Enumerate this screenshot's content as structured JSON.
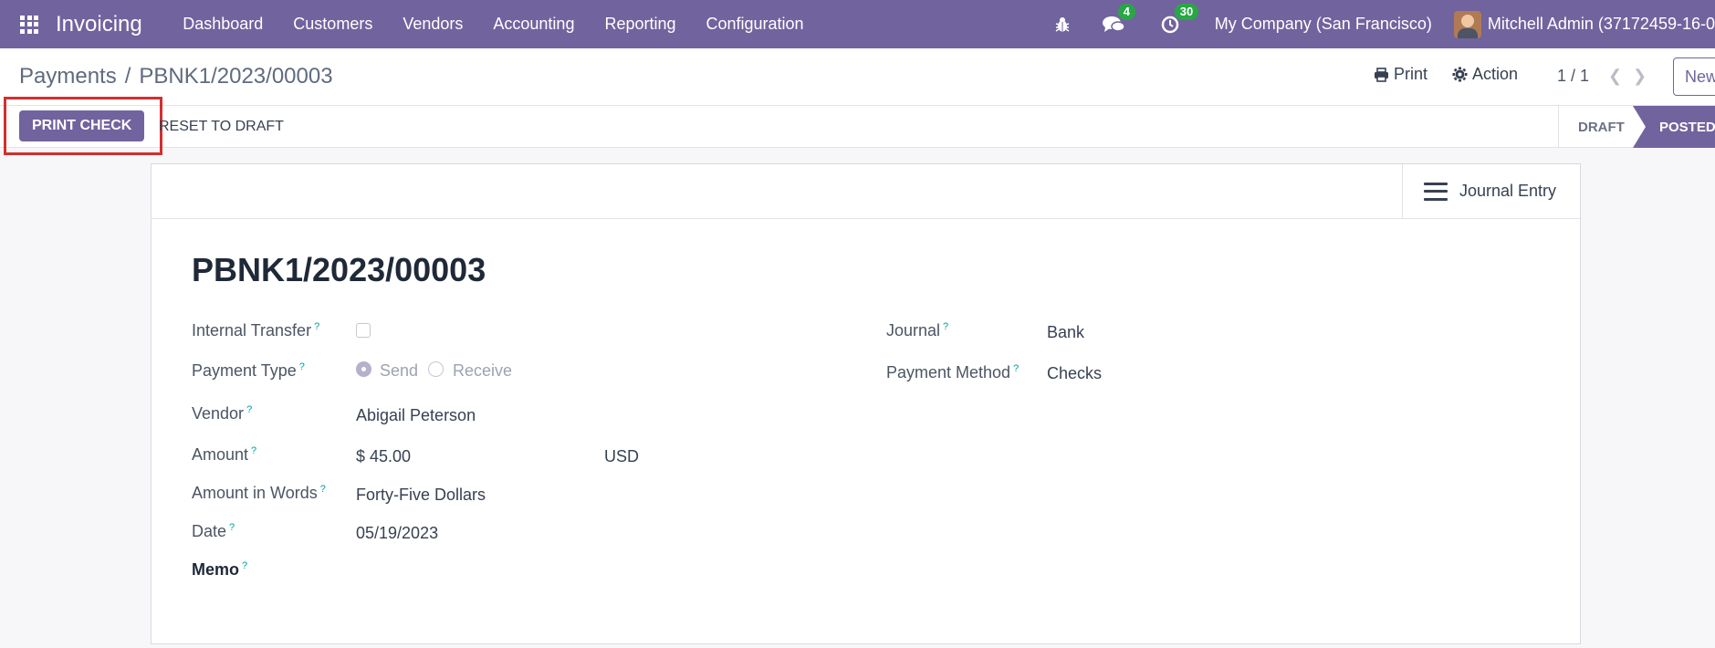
{
  "navbar": {
    "app_name": "Invoicing",
    "menu": [
      "Dashboard",
      "Customers",
      "Vendors",
      "Accounting",
      "Reporting",
      "Configuration"
    ],
    "chat_badge": "4",
    "activity_badge": "30",
    "company": "My Company (San Francisco)",
    "user": "Mitchell Admin (37172459-16-0"
  },
  "breadcrumb": {
    "parent": "Payments",
    "separator": "/",
    "current": "PBNK1/2023/00003"
  },
  "control": {
    "print_label": "Print",
    "action_label": "Action",
    "pager": "1 / 1",
    "new_label": "New"
  },
  "statusbar": {
    "print_check_label": "PRINT CHECK",
    "reset_label": "RESET TO DRAFT",
    "stages": [
      "DRAFT",
      "POSTED"
    ],
    "active_stage": "POSTED"
  },
  "smart_button": {
    "label": "Journal Entry",
    "icon": "bars-icon"
  },
  "form": {
    "title": "PBNK1/2023/00003",
    "help_marker": "?",
    "internal_transfer": {
      "label": "Internal Transfer",
      "checked": false
    },
    "payment_type": {
      "label": "Payment Type",
      "options": [
        "Send",
        "Receive"
      ],
      "selected": "Send"
    },
    "vendor": {
      "label": "Vendor",
      "value": "Abigail Peterson"
    },
    "amount": {
      "label": "Amount",
      "value": "$ 45.00",
      "currency": "USD"
    },
    "amount_in_words": {
      "label": "Amount in Words",
      "value": "Forty-Five Dollars"
    },
    "date": {
      "label": "Date",
      "value": "05/19/2023"
    },
    "memo": {
      "label": "Memo",
      "value": ""
    },
    "journal": {
      "label": "Journal",
      "value": "Bank"
    },
    "payment_method": {
      "label": "Payment Method",
      "value": "Checks"
    }
  },
  "colors": {
    "brand": "#71639e",
    "badge": "#28a745",
    "highlight": "#d32f2f",
    "help": "#00a09d"
  }
}
